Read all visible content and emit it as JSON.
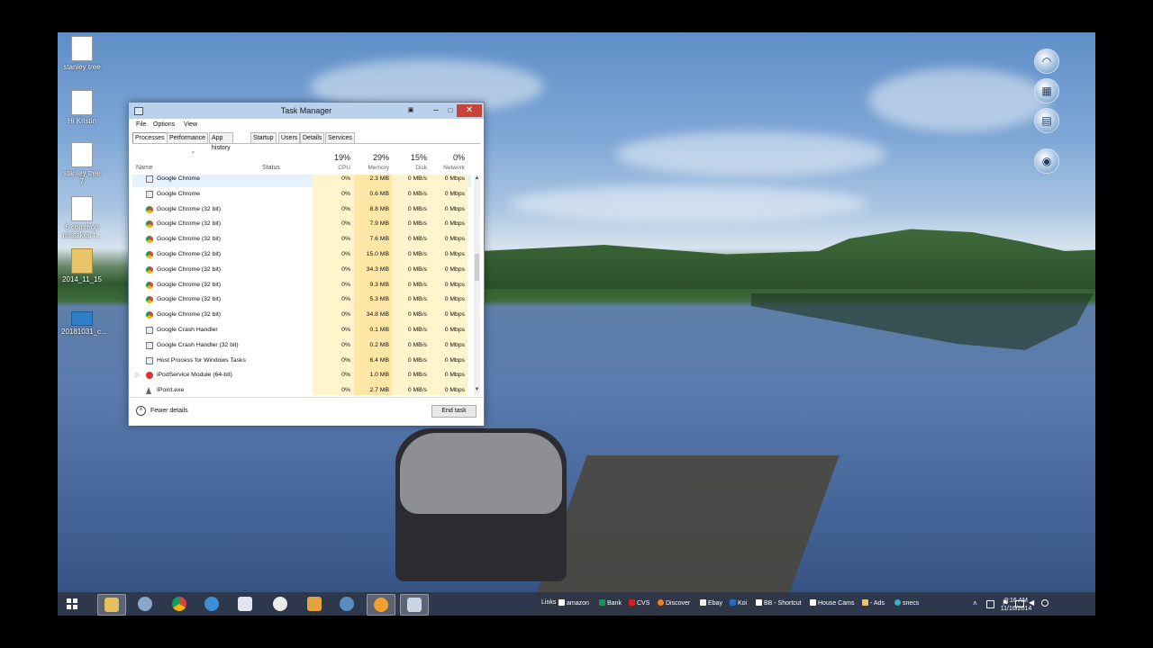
{
  "desktop_icons": [
    {
      "label": "stanley tree"
    },
    {
      "label": "Hi Kristin"
    },
    {
      "label": "stanley tree 7"
    },
    {
      "label": "6 common mistakes f..."
    },
    {
      "label": "2014_11_15"
    },
    {
      "label": "20181031_c..."
    }
  ],
  "task_manager": {
    "title": "Task Manager",
    "menu": [
      "File",
      "Options",
      "View"
    ],
    "tabs": [
      "Processes",
      "Performance",
      "App history",
      "Startup",
      "Users",
      "Details",
      "Services"
    ],
    "active_tab": "Processes",
    "columns": {
      "name": "Name",
      "status": "Status",
      "cpu": {
        "pct": "19%",
        "label": "CPU"
      },
      "memory": {
        "pct": "29%",
        "label": "Memory"
      },
      "disk": {
        "pct": "15%",
        "label": "Disk"
      },
      "network": {
        "pct": "0%",
        "label": "Network"
      }
    },
    "rows": [
      {
        "name": "Google Chrome",
        "icon": "window-icon",
        "cpu": "0%",
        "memory": "2.3 MB",
        "disk": "0 MB/s",
        "network": "0 Mbps"
      },
      {
        "name": "Google Chrome",
        "icon": "window-icon",
        "cpu": "0%",
        "memory": "0.6 MB",
        "disk": "0 MB/s",
        "network": "0 Mbps"
      },
      {
        "name": "Google Chrome (32 bit)",
        "icon": "chrome-icon",
        "cpu": "0%",
        "memory": "8.8 MB",
        "disk": "0 MB/s",
        "network": "0 Mbps"
      },
      {
        "name": "Google Chrome (32 bit)",
        "icon": "chrome-icon",
        "cpu": "0%",
        "memory": "7.9 MB",
        "disk": "0 MB/s",
        "network": "0 Mbps"
      },
      {
        "name": "Google Chrome (32 bit)",
        "icon": "chrome-icon",
        "cpu": "0%",
        "memory": "7.6 MB",
        "disk": "0 MB/s",
        "network": "0 Mbps"
      },
      {
        "name": "Google Chrome (32 bit)",
        "icon": "chrome-icon",
        "cpu": "0%",
        "memory": "15.0 MB",
        "disk": "0 MB/s",
        "network": "0 Mbps"
      },
      {
        "name": "Google Chrome (32 bit)",
        "icon": "chrome-icon",
        "cpu": "0%",
        "memory": "34.3 MB",
        "disk": "0 MB/s",
        "network": "0 Mbps"
      },
      {
        "name": "Google Chrome (32 bit)",
        "icon": "chrome-icon",
        "cpu": "0%",
        "memory": "9.3 MB",
        "disk": "0 MB/s",
        "network": "0 Mbps"
      },
      {
        "name": "Google Chrome (32 bit)",
        "icon": "chrome-icon",
        "cpu": "0%",
        "memory": "5.3 MB",
        "disk": "0 MB/s",
        "network": "0 Mbps"
      },
      {
        "name": "Google Chrome (32 bit)",
        "icon": "chrome-icon",
        "cpu": "0%",
        "memory": "34.8 MB",
        "disk": "0 MB/s",
        "network": "0 Mbps"
      },
      {
        "name": "Google Crash Handler",
        "icon": "window-icon",
        "cpu": "0%",
        "memory": "0.1 MB",
        "disk": "0 MB/s",
        "network": "0 Mbps"
      },
      {
        "name": "Google Crash Handler (32 bit)",
        "icon": "window-icon",
        "cpu": "0%",
        "memory": "0.2 MB",
        "disk": "0 MB/s",
        "network": "0 Mbps"
      },
      {
        "name": "Host Process for Windows Tasks",
        "icon": "window-icon",
        "cpu": "0%",
        "memory": "6.4 MB",
        "disk": "0 MB/s",
        "network": "0 Mbps"
      },
      {
        "name": "iPodService Module (64-bit)",
        "icon": "ipod-icon",
        "cpu": "0%",
        "memory": "1.0 MB",
        "disk": "0 MB/s",
        "network": "0 Mbps",
        "expandable": true
      },
      {
        "name": "IPoint.exe",
        "icon": "cursor-icon",
        "cpu": "0%",
        "memory": "2.7 MB",
        "disk": "0 MB/s",
        "network": "0 Mbps"
      }
    ],
    "fewer_details": "Fewer details",
    "end_task": "End task"
  },
  "taskbar": {
    "links_label": "Links",
    "links": [
      "amazon",
      "Bank",
      "CVS",
      "Discover",
      "Ebay",
      "Koi",
      "BB - Shortcut",
      "House Cams",
      "- Ads",
      "snecs"
    ],
    "clock": {
      "time": "9:16 AM",
      "date": "11/16/2014"
    }
  }
}
